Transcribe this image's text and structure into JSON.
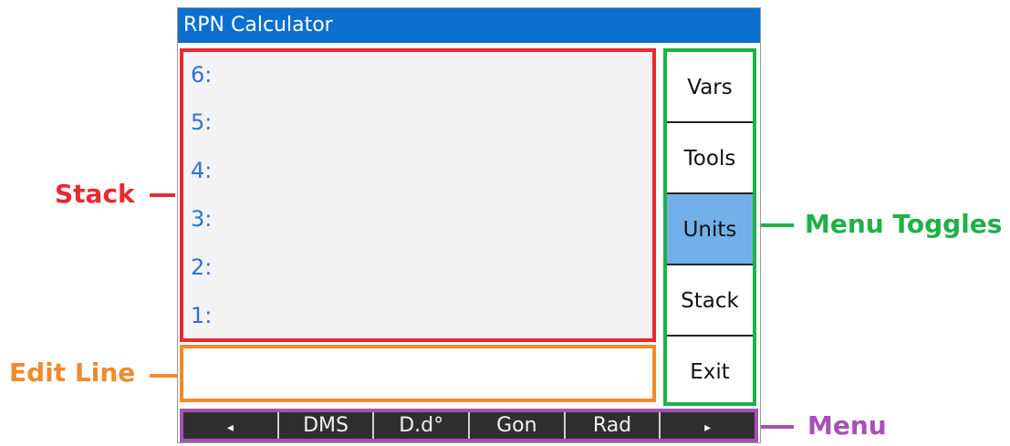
{
  "window": {
    "title": "RPN Calculator"
  },
  "stack": {
    "rows": [
      "6:",
      "5:",
      "4:",
      "3:",
      "2:",
      "1:"
    ]
  },
  "edit_line": {
    "value": ""
  },
  "menu_toggles": [
    {
      "label": "Vars",
      "active": false
    },
    {
      "label": "Tools",
      "active": false
    },
    {
      "label": "Units",
      "active": true
    },
    {
      "label": "Stack",
      "active": false
    },
    {
      "label": "Exit",
      "active": false
    }
  ],
  "menu": {
    "items": [
      "◂",
      "DMS",
      "D.d°",
      "Gon",
      "Rad",
      "▸"
    ]
  },
  "callouts": {
    "stack": "Stack",
    "edit_line": "Edit Line",
    "menu_toggles": "Menu Toggles",
    "menu": "Menu"
  },
  "colors": {
    "stack": "#e8292f",
    "edit_line": "#f08a2c",
    "menu_toggles": "#1fb047",
    "menu": "#a552b3",
    "title_bar": "#0a6fcf",
    "active_toggle": "#72b0ea",
    "stack_index": "#2a74d4"
  }
}
